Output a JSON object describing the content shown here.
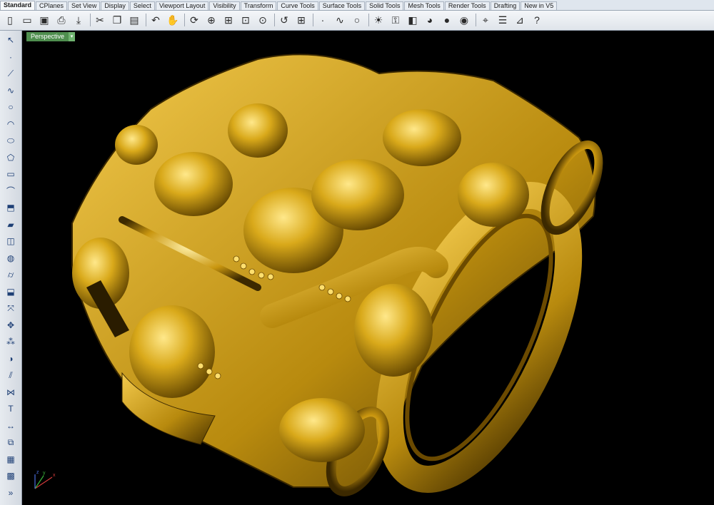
{
  "tabs": [
    "Standard",
    "CPlanes",
    "Set View",
    "Display",
    "Select",
    "Viewport Layout",
    "Visibility",
    "Transform",
    "Curve Tools",
    "Surface Tools",
    "Solid Tools",
    "Mesh Tools",
    "Render Tools",
    "Drafting",
    "New in V5"
  ],
  "active_tab": "Standard",
  "toolbar": {
    "tools": [
      "new-icon",
      "open-icon",
      "save-icon",
      "print-icon",
      "import-icon",
      "sep",
      "cut-icon",
      "copy-icon",
      "paste-icon",
      "sep",
      "undo-icon",
      "pan-hand-icon",
      "sep",
      "rotate-view-icon",
      "zoom-icon",
      "zoom-window-icon",
      "zoom-extents-icon",
      "zoom-selected-icon",
      "sep",
      "undo-view-icon",
      "four-view-icon",
      "sep",
      "point-icon",
      "curve-icon",
      "circle-icon",
      "sep",
      "light-icon",
      "lock-icon",
      "layer-icon",
      "color-wheel-icon",
      "sphere-shaded-icon",
      "sphere-rendered-icon",
      "sep",
      "osnap-icon",
      "properties-icon",
      "analyze-icon",
      "help-icon"
    ]
  },
  "sidebar": {
    "tools": [
      "select-arrow-icon",
      "point-icon",
      "polyline-icon",
      "curve-icon",
      "circle-icon",
      "arc-icon",
      "ellipse-icon",
      "polygon-icon",
      "rectangle-icon",
      "fillet-icon",
      "extrude-icon",
      "surface-icon",
      "box-icon",
      "sphere-icon",
      "cylinder-icon",
      "patch-icon",
      "transform-icon",
      "move-icon",
      "array-icon",
      "boolean-icon",
      "split-icon",
      "join-icon",
      "text-icon",
      "dimension-icon",
      "group-icon",
      "block-icon",
      "mesh-icon",
      "more-icon"
    ]
  },
  "viewport": {
    "label": "Perspective",
    "menu_arrow": "▾",
    "background": "#000000"
  },
  "axes": {
    "x": "x",
    "y": "y",
    "z": "z"
  },
  "colors": {
    "gold": "#d9a91a",
    "gold_dark": "#7a5600",
    "gold_light": "#ffe27a",
    "x_axis": "#d23a3a",
    "y_axis": "#3bb33b",
    "z_axis": "#4a6ee0"
  }
}
